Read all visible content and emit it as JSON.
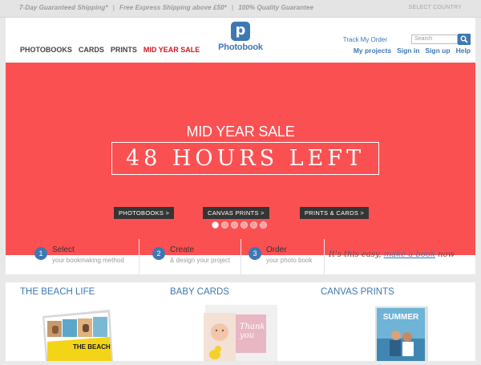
{
  "topbar": {
    "promos": [
      "7-Day Guaranteed Shipping*",
      "Free Express Shipping above £50*",
      "100% Quality Guarantee"
    ],
    "separator": "|",
    "country": "SELECT COUNTRY"
  },
  "nav": {
    "items": [
      "PHOTOBOOKS",
      "CARDS",
      "PRINTS"
    ],
    "sale": "MID YEAR SALE"
  },
  "logo": {
    "glyph": "p",
    "word": "Photobook"
  },
  "account": {
    "track": "Track My Order",
    "search_placeholder": "Search",
    "links": [
      "My projects",
      "Sign in",
      "Sign up",
      "Help"
    ]
  },
  "hero": {
    "kicker": "MID YEAR SALE",
    "headline": "48 HOURS LEFT",
    "ctas": [
      "PHOTOBOOKS >",
      "CANVAS PRINTS >",
      "PRINTS & CARDS >"
    ],
    "dots_count": 6,
    "active_dot": 1
  },
  "steps": [
    {
      "num": "1",
      "title": "Select",
      "sub": "your bookmaking method"
    },
    {
      "num": "2",
      "title": "Create",
      "sub": "& design your project"
    },
    {
      "num": "3",
      "title": "Order",
      "sub": "your photo book"
    }
  ],
  "tagline": {
    "before": "It's this easy,",
    "link": "make a book",
    "after": "now"
  },
  "products": [
    {
      "title": "THE BEACH LIFE",
      "cover_text": "THE BEACH"
    },
    {
      "title": "BABY CARDS",
      "card_text": "Thank you"
    },
    {
      "title": "CANVAS PRINTS",
      "cover_text": "SUMMER"
    }
  ],
  "colors": {
    "brand_blue": "#3d78b3",
    "hero_red": "#fb5052",
    "sale_red": "#d8131b"
  }
}
